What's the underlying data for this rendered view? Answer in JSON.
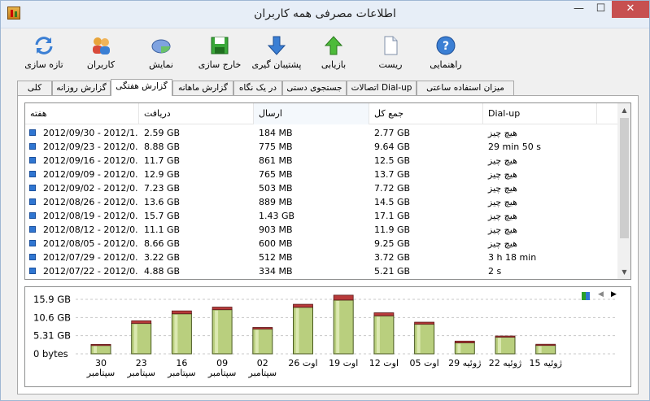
{
  "window": {
    "title": "اطلاعات مصرفی همه کاربران",
    "minimize": "—",
    "maximize": "☐",
    "close": "✕"
  },
  "toolbar": {
    "help": "راهنمایی",
    "reset": "ریست",
    "restore": "بازیابی",
    "backup": "پشتیبان گیری",
    "export": "خارج سازی",
    "view": "نمایش",
    "users": "کاربران",
    "refresh": "تازه سازی"
  },
  "tabs": [
    "میزان استفاده ساعتی",
    "اتصالات Dial-up",
    "جستجوی دستی",
    "در یک نگاه",
    "گزارش ماهانه",
    "گزارش هفتگی",
    "گزارش روزانه",
    "کلی"
  ],
  "active_tab": "گزارش هفتگی",
  "table": {
    "columns": [
      "هفته",
      "دریافت",
      "ارسال",
      "جمع کل",
      "Dial-up"
    ],
    "rows": [
      [
        "2012/09/30 - 2012/1...",
        "2.59 GB",
        "184 MB",
        "2.77 GB",
        "هیچ چیز"
      ],
      [
        "2012/09/23 - 2012/0...",
        "8.88 GB",
        "775 MB",
        "9.64 GB",
        "29 min 50 s"
      ],
      [
        "2012/09/16 - 2012/0...",
        "11.7 GB",
        "861 MB",
        "12.5 GB",
        "هیچ چیز"
      ],
      [
        "2012/09/09 - 2012/0...",
        "12.9 GB",
        "765 MB",
        "13.7 GB",
        "هیچ چیز"
      ],
      [
        "2012/09/02 - 2012/0...",
        "7.23 GB",
        "503 MB",
        "7.72 GB",
        "هیچ چیز"
      ],
      [
        "2012/08/26 - 2012/0...",
        "13.6 GB",
        "889 MB",
        "14.5 GB",
        "هیچ چیز"
      ],
      [
        "2012/08/19 - 2012/0...",
        "15.7 GB",
        "1.43 GB",
        "17.1 GB",
        "هیچ چیز"
      ],
      [
        "2012/08/12 - 2012/0...",
        "11.1 GB",
        "903 MB",
        "11.9 GB",
        "هیچ چیز"
      ],
      [
        "2012/08/05 - 2012/0...",
        "8.66 GB",
        "600 MB",
        "9.25 GB",
        "هیچ چیز"
      ],
      [
        "2012/07/29 - 2012/0...",
        "3.22 GB",
        "512 MB",
        "3.72 GB",
        "3 h 18 min"
      ],
      [
        "2012/07/22 - 2012/0...",
        "4.88 GB",
        "334 MB",
        "5.21 GB",
        "2 s"
      ]
    ]
  },
  "scroll": {
    "up": "▲",
    "down": "▼"
  },
  "chart_nav": {
    "prev": "◀",
    "next": "▶"
  },
  "chart_data": {
    "type": "bar",
    "yticks": [
      "15.9 GB",
      "10.6 GB",
      "5.31 GB",
      "0 bytes"
    ],
    "ylim": [
      0,
      17.1
    ],
    "categories": [
      [
        "30",
        "سپتامبر"
      ],
      [
        "23",
        "سپتامبر"
      ],
      [
        "16",
        "سپتامبر"
      ],
      [
        "09",
        "سپتامبر"
      ],
      [
        "02",
        "سپتامبر"
      ],
      [
        "اوت 26"
      ],
      [
        "اوت 19"
      ],
      [
        "اوت 12"
      ],
      [
        "اوت 05"
      ],
      [
        "ژوئیه 29"
      ],
      [
        "ژوئیه 22"
      ],
      [
        "ژوئیه 15"
      ]
    ],
    "series": [
      {
        "values": [
          2.59,
          8.88,
          11.7,
          12.9,
          7.23,
          13.6,
          15.7,
          11.1,
          8.66,
          3.22,
          4.88,
          2.5
        ]
      },
      {
        "values": [
          0.18,
          0.76,
          0.84,
          0.75,
          0.49,
          0.87,
          1.43,
          0.88,
          0.59,
          0.5,
          0.33,
          0.3
        ]
      }
    ],
    "colors": {
      "download": "#b9cf7e",
      "upload": "#b83a3a",
      "grid": "#c8c8c8"
    }
  }
}
